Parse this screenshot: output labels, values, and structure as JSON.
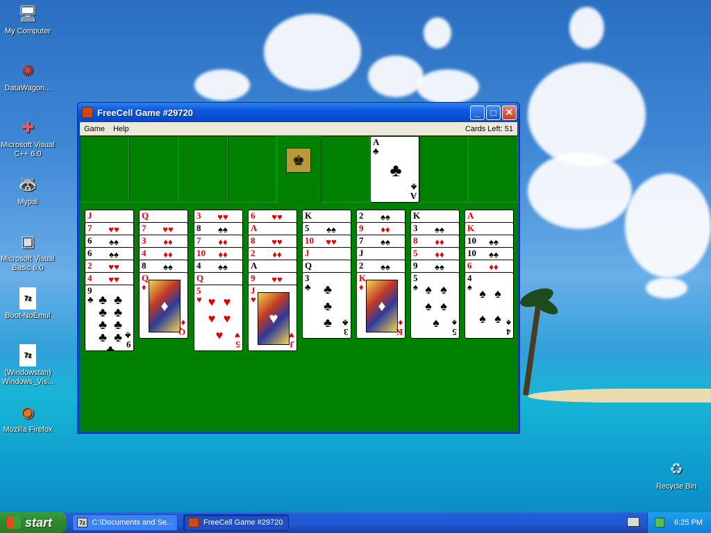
{
  "desktop": {
    "icons": [
      {
        "label": "My Computer",
        "icon": "computer-icon"
      },
      {
        "label": "DataWagon...",
        "icon": "shortcut-icon"
      },
      {
        "label": "Microsoft Visual C++ 6.0",
        "icon": "visual-cpp-icon"
      },
      {
        "label": "Mypal",
        "icon": "mypal-icon"
      },
      {
        "label": "Microsoft Visual Basic 6.0",
        "icon": "visual-basic-icon"
      },
      {
        "label": "Boot-NoEmul",
        "icon": "7z-file-icon"
      },
      {
        "label": "(Windowstan) Windows_Vis...",
        "icon": "7z-file-icon"
      },
      {
        "label": "Mozilla Firefox",
        "icon": "firefox-icon"
      },
      {
        "label": "Recycle Bin",
        "icon": "recycle-bin-icon"
      }
    ]
  },
  "window": {
    "title": "FreeCell Game #29720",
    "menu": [
      "Game",
      "Help"
    ],
    "cards_left": "Cards Left: 51"
  },
  "game": {
    "free_cells": [
      "",
      "",
      "",
      ""
    ],
    "home_cells": [
      "",
      "A♣",
      "",
      ""
    ],
    "columns": [
      [
        "J♥",
        "7♥",
        "6♠",
        "6♠",
        "2♥",
        "4♥",
        "9♣"
      ],
      [
        "Q♦",
        "7♥",
        "3♦",
        "4♦",
        "8♠",
        "Q♦"
      ],
      [
        "3♥",
        "8♠",
        "7♦",
        "10♦",
        "4♠",
        "Q♦",
        "5♥"
      ],
      [
        "6♥",
        "A♦",
        "8♥",
        "2♦",
        "A♠",
        "9♥",
        "J♥"
      ],
      [
        "K♠",
        "5♠",
        "10♥",
        "J♦",
        "Q♠",
        "3♣"
      ],
      [
        "2♠",
        "9♦",
        "7♠",
        "J♠",
        "2♠",
        "K♦"
      ],
      [
        "K♠",
        "3♠",
        "8♦",
        "5♦",
        "9♠",
        "5♠"
      ],
      [
        "A♦",
        "K♦",
        "10♠",
        "10♠",
        "6♦",
        "4♠"
      ]
    ]
  },
  "taskbar": {
    "start_label": "start",
    "tasks": [
      {
        "label": "C:\\Documents and Se...",
        "icon": "7z-icon",
        "active": false
      },
      {
        "label": "FreeCell Game #29720",
        "icon": "freecell-icon",
        "active": true
      }
    ],
    "clock": "6:25 PM"
  }
}
